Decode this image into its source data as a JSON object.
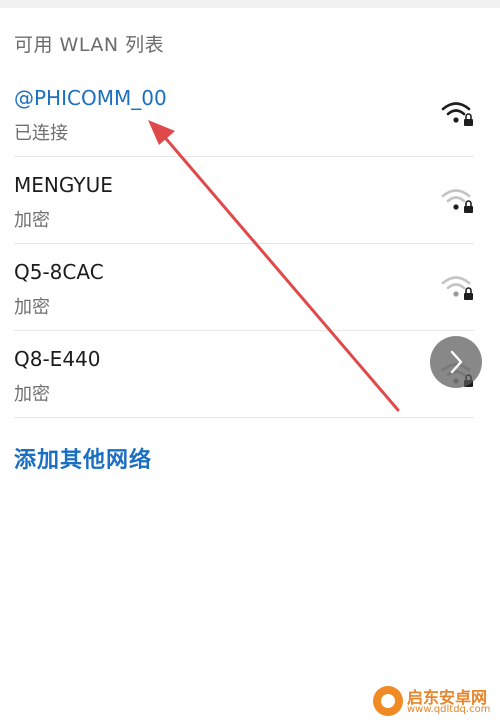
{
  "section_header": "可用 WLAN 列表",
  "networks": [
    {
      "name": "@PHICOMM_00",
      "status": "已连接",
      "connected": true,
      "signal_icon": "wifi-strong-locked-icon"
    },
    {
      "name": "MENGYUE",
      "status": "加密",
      "connected": false,
      "signal_icon": "wifi-weak-locked-icon"
    },
    {
      "name": "Q5-8CAC",
      "status": "加密",
      "connected": false,
      "signal_icon": "wifi-weak-locked-icon"
    },
    {
      "name": "Q8-E440",
      "status": "加密",
      "connected": false,
      "signal_icon": "wifi-locked-icon"
    }
  ],
  "add_network_label": "添加其他网络",
  "floating_button_icon": "chevron-right-icon",
  "watermark": {
    "title": "启东安卓网",
    "url": "www.qdltdq.com"
  },
  "colors": {
    "accent": "#1b6fc3",
    "annotation_arrow": "#e0494a",
    "watermark": "#e8842a"
  }
}
